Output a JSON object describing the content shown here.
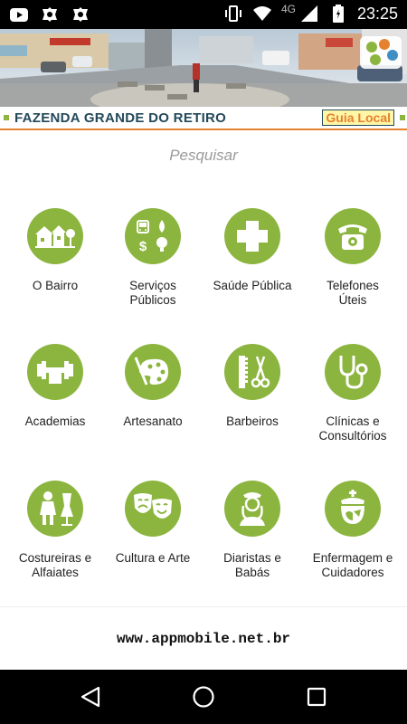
{
  "status_bar": {
    "time": "23:25",
    "network": "4G",
    "notification_icons": [
      "youtube-icon",
      "app-icon",
      "app-icon"
    ],
    "system_icons": [
      "vibrate-icon",
      "wifi-icon",
      "signal-icon",
      "battery-icon"
    ]
  },
  "header": {
    "title": "FAZENDA GRANDE DO RETIRO",
    "brand_badge": "Guia Local",
    "accent_color": "#e6812e",
    "title_color": "#23495a"
  },
  "search": {
    "placeholder": "Pesquisar"
  },
  "categories": [
    {
      "label": "O Bairro",
      "icon": "neighborhood-icon"
    },
    {
      "label": "Serviços\nPúblicos",
      "icon": "public-services-icon"
    },
    {
      "label": "Saúde Pública",
      "icon": "health-cross-icon"
    },
    {
      "label": "Telefones\nÚteis",
      "icon": "telephone-icon"
    },
    {
      "label": "Academias",
      "icon": "gym-icon"
    },
    {
      "label": "Artesanato",
      "icon": "palette-icon"
    },
    {
      "label": "Barbeiros",
      "icon": "comb-scissors-icon"
    },
    {
      "label": "Clínicas e\nConsultórios",
      "icon": "stethoscope-icon"
    },
    {
      "label": "Costureiras e\nAlfaiates",
      "icon": "seamstress-icon"
    },
    {
      "label": "Cultura e Arte",
      "icon": "theater-masks-icon"
    },
    {
      "label": "Diaristas e\nBabás",
      "icon": "maid-icon"
    },
    {
      "label": "Enfermagem e\nCuidadores",
      "icon": "nurse-icon"
    }
  ],
  "icon_color": "#8cb53f",
  "footer": {
    "url": "www.appmobile.net.br"
  },
  "nav_bar": {
    "buttons": [
      "back-icon",
      "home-icon",
      "recents-icon"
    ]
  }
}
